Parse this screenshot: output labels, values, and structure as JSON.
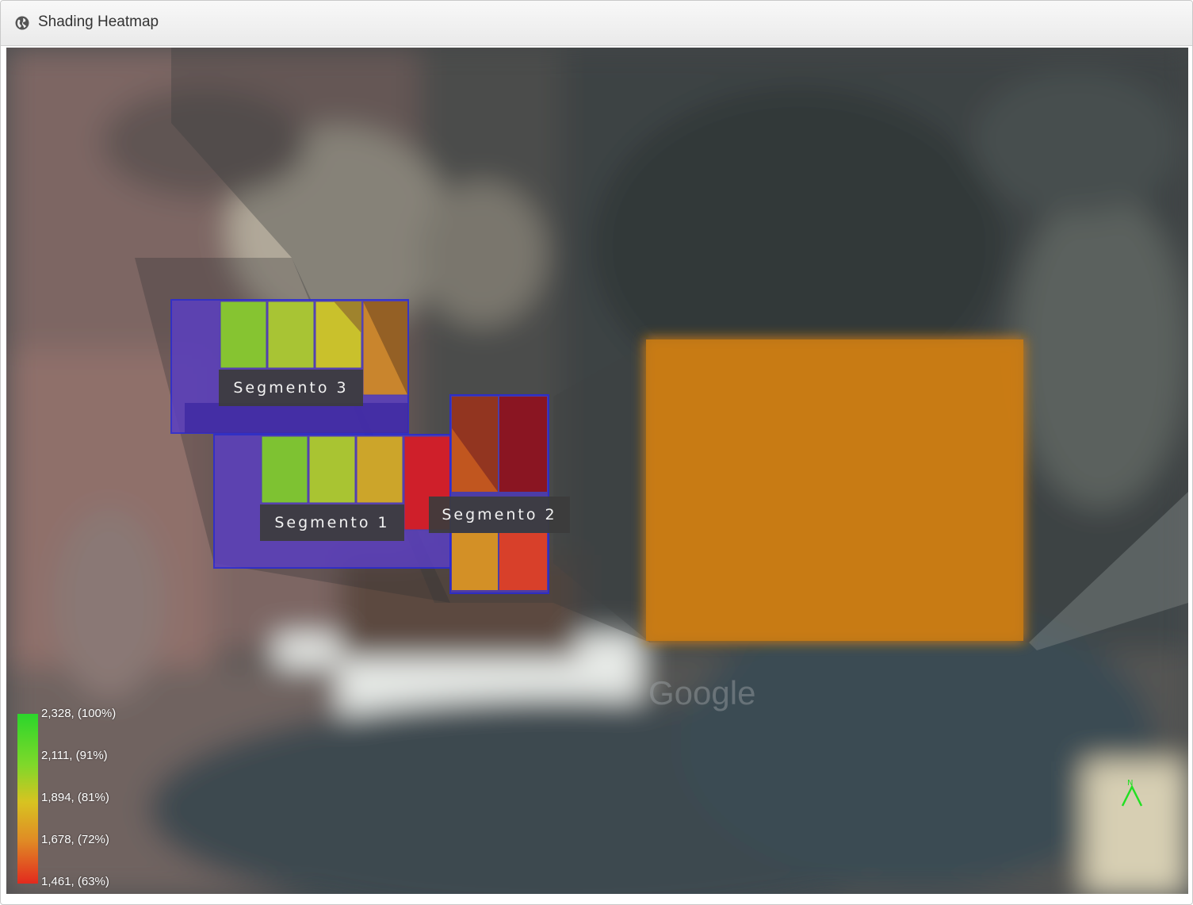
{
  "window": {
    "title": "Shading Heatmap",
    "icon": "globe-icon"
  },
  "map": {
    "watermark": "Google",
    "segments": [
      {
        "label": "Segmento 3"
      },
      {
        "label": "Segmento 1"
      },
      {
        "label": "Segmento 2"
      }
    ],
    "legend": {
      "colors": {
        "top": "#2bd62b",
        "bottom": "#e22a1e"
      },
      "entries": [
        "2,328, (100%)",
        "2,111, (91%)",
        "1,894, (81%)",
        "1,678, (72%)",
        "1,461, (63%)"
      ]
    },
    "north_label": "N"
  }
}
